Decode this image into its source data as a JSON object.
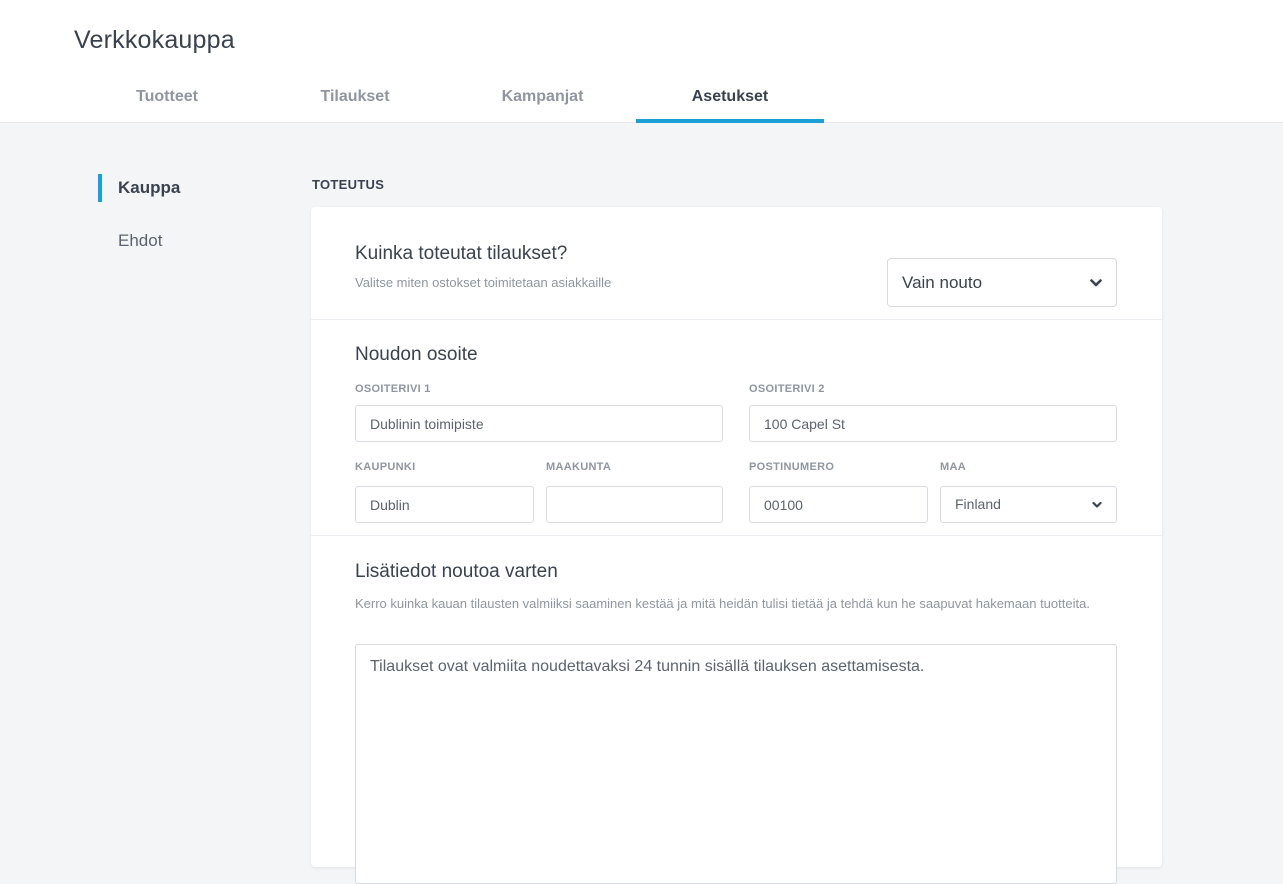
{
  "app": {
    "title": "Verkkokauppa"
  },
  "tabs": [
    {
      "label": "Tuotteet"
    },
    {
      "label": "Tilaukset"
    },
    {
      "label": "Kampanjat"
    },
    {
      "label": "Asetukset",
      "active": true
    }
  ],
  "sidebar": {
    "items": [
      {
        "label": "Kauppa",
        "active": true
      },
      {
        "label": "Ehdot",
        "active": false
      }
    ]
  },
  "section": {
    "label": "TOTEUTUS"
  },
  "fulfillment": {
    "title": "Kuinka toteutat tilaukset?",
    "subtitle": "Valitse miten ostokset toimitetaan asiakkaille",
    "selected": "Vain nouto"
  },
  "pickup_address": {
    "title": "Noudon osoite",
    "line1_label": "OSOITERIVI 1",
    "line1_value": "Dublinin toimipiste",
    "line2_label": "OSOITERIVI 2",
    "line2_value": "100 Capel St",
    "city_label": "KAUPUNKI",
    "city_value": "Dublin",
    "region_label": "MAAKUNTA",
    "region_value": "",
    "postal_label": "POSTINUMERO",
    "postal_value": "00100",
    "country_label": "MAA",
    "country_value": "Finland"
  },
  "pickup_info": {
    "title": "Lisätiedot noutoa varten",
    "description": "Kerro kuinka kauan tilausten valmiiksi saaminen kestää ja mitä heidän tulisi tietää ja tehdä kun he saapuvat hakemaan tuotteita.",
    "value": "Tilaukset ovat valmiita noudettavaksi 24 tunnin sisällä tilauksen asettamisesta."
  },
  "colors": {
    "accent": "#1aa0d6",
    "background": "#f4f5f7",
    "text": "#3a4250",
    "muted": "#8f96a1"
  }
}
